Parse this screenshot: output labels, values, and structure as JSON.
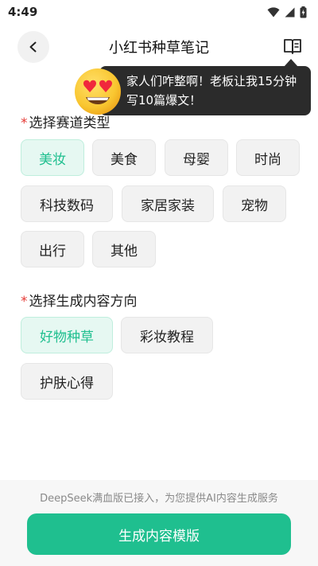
{
  "status": {
    "time": "4:49"
  },
  "header": {
    "title": "小红书种草笔记"
  },
  "tooltip": {
    "text": "家人们咋整啊！老板让我15分钟写10篇爆文！"
  },
  "section1": {
    "required_mark": "*",
    "title": "选择赛道类型",
    "chips": [
      {
        "label": "美妆",
        "selected": true
      },
      {
        "label": "美食",
        "selected": false
      },
      {
        "label": "母婴",
        "selected": false
      },
      {
        "label": "时尚",
        "selected": false
      },
      {
        "label": "科技数码",
        "selected": false
      },
      {
        "label": "家居家装",
        "selected": false
      },
      {
        "label": "宠物",
        "selected": false
      },
      {
        "label": "出行",
        "selected": false
      },
      {
        "label": "其他",
        "selected": false
      }
    ]
  },
  "section2": {
    "required_mark": "*",
    "title": "选择生成内容方向",
    "chips": [
      {
        "label": "好物种草",
        "selected": true
      },
      {
        "label": "彩妆教程",
        "selected": false
      },
      {
        "label": "护肤心得",
        "selected": false
      }
    ]
  },
  "footer": {
    "note": "DeepSeek满血版已接入，为您提供AI内容生成服务",
    "button_label": "生成内容模版"
  },
  "colors": {
    "accent": "#1fbf8f",
    "selected_bg": "#e6f8f2",
    "required": "#e53935",
    "tooltip_bg": "#2b2b2b"
  },
  "icons": {
    "back": "chevron-left-icon",
    "guide": "book-icon",
    "emoji": "heart-eyes-emoji-icon"
  }
}
